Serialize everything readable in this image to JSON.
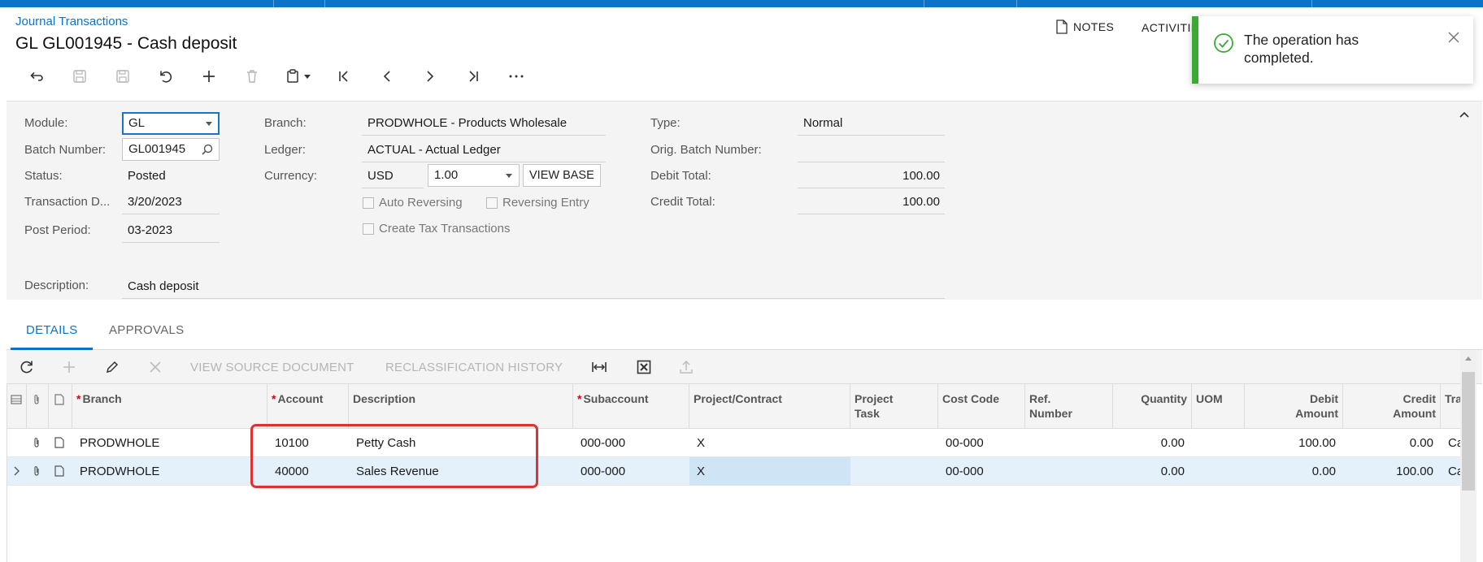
{
  "colors": {
    "accent": "#0b73c8",
    "success": "#3aaa35",
    "highlight": "#e03131"
  },
  "header": {
    "breadcrumb": "Journal Transactions",
    "title": "GL GL001945 - Cash deposit",
    "notes_label": "NOTES",
    "activities_label": "ACTIVITIES"
  },
  "toolbar": {
    "icons": [
      "back-icon",
      "save-close-icon",
      "save-icon",
      "undo-icon",
      "add-icon",
      "delete-icon",
      "clipboard-icon",
      "first-record-icon",
      "previous-record-icon",
      "next-record-icon",
      "last-record-icon",
      "more-icon"
    ]
  },
  "toast": {
    "message": "The operation has completed."
  },
  "form": {
    "module_label": "Module:",
    "module_value": "GL",
    "batch_label": "Batch Number:",
    "batch_value": "GL001945",
    "status_label": "Status:",
    "status_value": "Posted",
    "trandate_label": "Transaction D...",
    "trandate_value": "3/20/2023",
    "period_label": "Post Period:",
    "period_value": "03-2023",
    "description_label": "Description:",
    "description_value": "Cash deposit",
    "branch_label": "Branch:",
    "branch_value": "PRODWHOLE - Products Wholesale",
    "ledger_label": "Ledger:",
    "ledger_value": "ACTUAL - Actual Ledger",
    "currency_label": "Currency:",
    "currency_value": "USD",
    "rate_value": "1.00",
    "view_base_label": "VIEW BASE",
    "auto_reversing_label": "Auto Reversing",
    "reversing_entry_label": "Reversing Entry",
    "create_tax_label": "Create Tax Transactions",
    "type_label": "Type:",
    "type_value": "Normal",
    "orig_batch_label": "Orig. Batch Number:",
    "orig_batch_value": "",
    "debit_total_label": "Debit Total:",
    "debit_total_value": "100.00",
    "credit_total_label": "Credit Total:",
    "credit_total_value": "100.00"
  },
  "tabs": {
    "details": "DETAILS",
    "approvals": "APPROVALS"
  },
  "grid_toolbar": {
    "view_source": "VIEW SOURCE DOCUMENT",
    "reclass_history": "RECLASSIFICATION HISTORY"
  },
  "grid": {
    "columns": {
      "branch": "Branch",
      "account": "Account",
      "description": "Description",
      "subaccount": "Subaccount",
      "project": "Project/Contract",
      "project_task": "Project Task",
      "cost_code": "Cost Code",
      "ref_number": "Ref. Number",
      "quantity": "Quantity",
      "uom": "UOM",
      "debit": "Debit Amount",
      "credit": "Credit Amount",
      "tran": "Tran"
    },
    "rows": [
      {
        "branch": "PRODWHOLE",
        "account": "10100",
        "description": "Petty Cash",
        "subaccount": "000-000",
        "project": "X",
        "project_task": "",
        "cost_code": "00-000",
        "ref_number": "",
        "quantity": "0.00",
        "uom": "",
        "debit": "100.00",
        "credit": "0.00",
        "tran": "Ca"
      },
      {
        "branch": "PRODWHOLE",
        "account": "40000",
        "description": "Sales Revenue",
        "subaccount": "000-000",
        "project": "X",
        "project_task": "",
        "cost_code": "00-000",
        "ref_number": "",
        "quantity": "0.00",
        "uom": "",
        "debit": "0.00",
        "credit": "100.00",
        "tran": "Ca"
      }
    ]
  }
}
